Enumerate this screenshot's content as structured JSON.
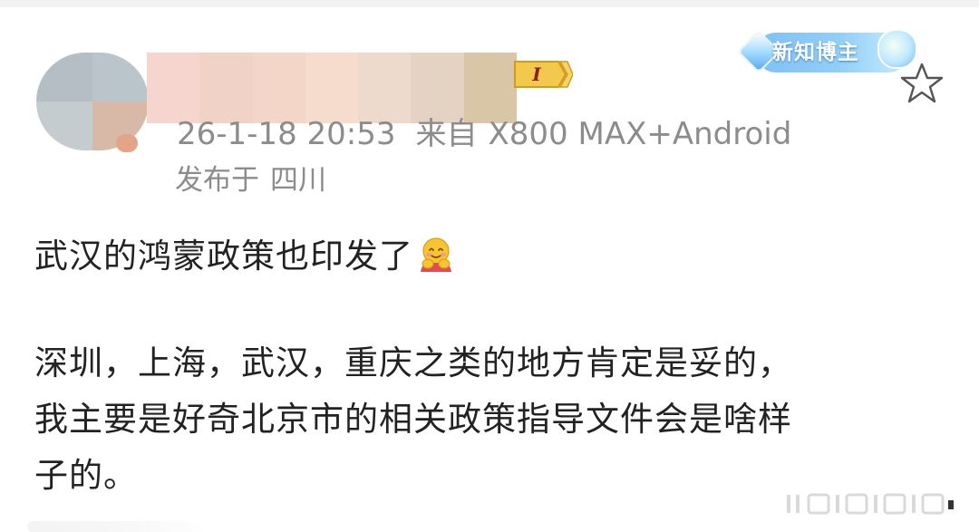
{
  "post": {
    "author": {
      "level_badge": "I"
    },
    "blogger_badge": {
      "label": "新知博主",
      "icon": "gem-icon"
    },
    "meta": {
      "timestamp": "26-1-18 20:53",
      "source_prefix": "来自",
      "source_device": "X800 MAX+Android",
      "location_prefix": "发布于",
      "location": "四川"
    },
    "favorite_icon": "star-outline-icon",
    "paragraph_1": "武汉的鸿蒙政策也印发了",
    "emoji": "hug-emoji-icon",
    "paragraph_2_lines": [
      "深圳，上海，武汉，重庆之类的地方肯定是妥的，",
      "我主要是好奇北京市的相关政策指导文件会是啥样",
      "子的。"
    ]
  },
  "colors": {
    "meta_text": "#8c8c8c",
    "body_text": "#222222",
    "badge_blue": "#7fc0f6",
    "level_gold": "#f2c94c"
  }
}
